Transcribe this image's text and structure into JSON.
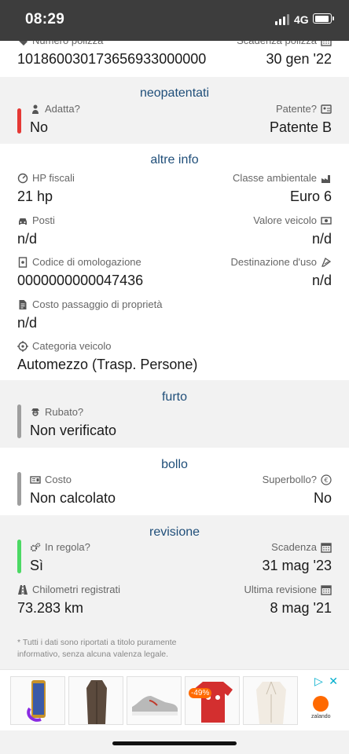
{
  "status": {
    "time": "08:29",
    "network": "4G"
  },
  "top_row": {
    "policy_label": "Numero polizza",
    "policy_value": "101860030173656933000000",
    "expiry_label": "Scadenza polizza",
    "expiry_value": "30 gen '22"
  },
  "neopatentati": {
    "title": "neopatentati",
    "left_label": "Adatta?",
    "left_value": "No",
    "right_label": "Patente?",
    "right_value": "Patente B",
    "status_color": "#e53935"
  },
  "altre_info": {
    "title": "altre info",
    "hp_label": "HP fiscali",
    "hp_value": "21 hp",
    "classe_label": "Classe ambientale",
    "classe_value": "Euro 6",
    "posti_label": "Posti",
    "posti_value": "n/d",
    "valore_label": "Valore veicolo",
    "valore_value": "n/d",
    "omol_label": "Codice di omologazione",
    "omol_value": "0000000000047436",
    "dest_label": "Destinazione d'uso",
    "dest_value": "n/d",
    "costo_label": "Costo passaggio di proprietà",
    "costo_value": "n/d",
    "cat_label": "Categoria veicolo",
    "cat_value": "Automezzo (Trasp. Persone)"
  },
  "furto": {
    "title": "furto",
    "label": "Rubato?",
    "value": "Non verificato",
    "status_color": "#9e9e9e"
  },
  "bollo": {
    "title": "bollo",
    "costo_label": "Costo",
    "costo_value": "Non calcolato",
    "superbollo_label": "Superbollo?",
    "superbollo_value": "No",
    "status_color": "#9e9e9e"
  },
  "revisione": {
    "title": "revisione",
    "regola_label": "In regola?",
    "regola_value": "Sì",
    "scadenza_label": "Scadenza",
    "scadenza_value": "31 mag '23",
    "km_label": "Chilometri registrati",
    "km_value": "73.283 km",
    "ultima_label": "Ultima revisione",
    "ultima_value": "8 mag '21",
    "status_color": "#4cd964"
  },
  "disclaimer": "* Tutti i dati sono riportati a titolo puramente informativo, senza alcuna valenza legale.",
  "ad": {
    "discount": "-49%",
    "brand": "zalando"
  },
  "colors": {
    "accent_title": "#1f4e79",
    "status_bar": "#3d3d3d"
  }
}
